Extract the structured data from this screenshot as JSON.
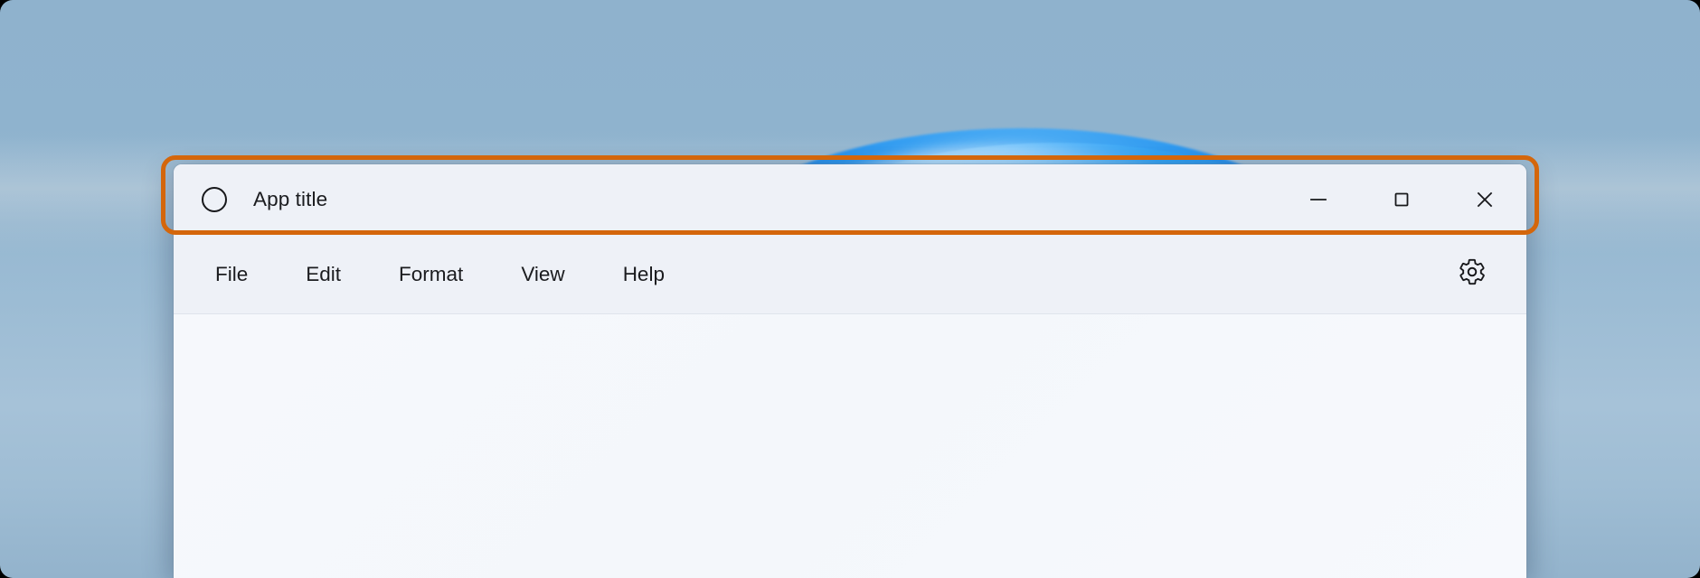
{
  "desktop": {
    "wallpaper_name": "windows-bloom-wallpaper",
    "background_color": "#8fb2cd",
    "bloom_color": "#2e9bf2"
  },
  "window": {
    "titlebar": {
      "app_icon": "circle-icon",
      "title": "App title",
      "controls": [
        {
          "name": "minimize",
          "label": "Minimize",
          "glyph": "minimize-icon"
        },
        {
          "name": "maximize",
          "label": "Maximize",
          "glyph": "maximize-icon"
        },
        {
          "name": "close",
          "label": "Close",
          "glyph": "close-icon"
        }
      ]
    },
    "menubar": {
      "items": [
        {
          "label": "File"
        },
        {
          "label": "Edit"
        },
        {
          "label": "Format"
        },
        {
          "label": "View"
        },
        {
          "label": "Help"
        }
      ],
      "settings": {
        "label": "Settings",
        "icon": "gear-icon"
      }
    },
    "client": {
      "content": "",
      "background_color": "#f6f8fc"
    }
  },
  "annotation": {
    "type": "highlight-rectangle",
    "target": "titlebar",
    "color": "#d4660b",
    "stroke_width": 5
  }
}
